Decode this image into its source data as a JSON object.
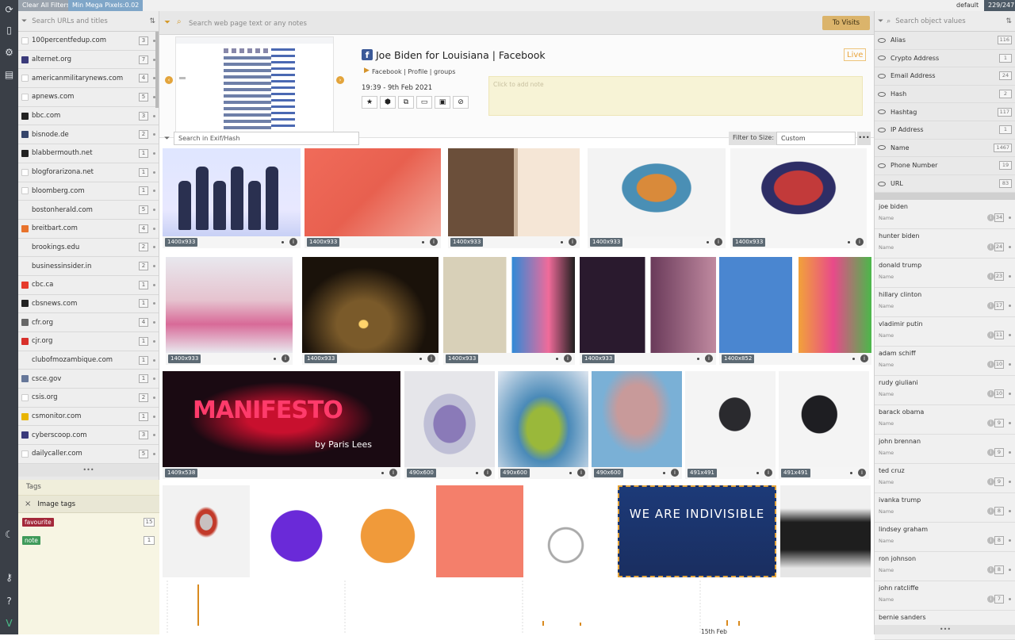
{
  "topbar": {
    "clear_filters": "Clear All Filters",
    "min_pixels": "Min Mega Pixels:0.02",
    "profile": "default",
    "counter": "229/247"
  },
  "left": {
    "search_placeholder": "Search URLs and titles",
    "domains": [
      {
        "name": "100percentfedup.com",
        "count": "3",
        "color": "#ffffff"
      },
      {
        "name": "alternet.org",
        "count": "7",
        "color": "#3a3a7a"
      },
      {
        "name": "americanmilitarynews.com",
        "count": "4",
        "color": "#ffffff"
      },
      {
        "name": "apnews.com",
        "count": "5",
        "color": "#ffffff"
      },
      {
        "name": "bbc.com",
        "count": "3",
        "color": "#222222"
      },
      {
        "name": "bisnode.de",
        "count": "2",
        "color": "#35456a"
      },
      {
        "name": "blabbermouth.net",
        "count": "1",
        "color": "#222222"
      },
      {
        "name": "blogforarizona.net",
        "count": "1",
        "color": "#ffffff"
      },
      {
        "name": "bloomberg.com",
        "count": "1",
        "color": "#ffffff"
      },
      {
        "name": "bostonherald.com",
        "count": "5",
        "color": "transparent"
      },
      {
        "name": "breitbart.com",
        "count": "4",
        "color": "#e8732c"
      },
      {
        "name": "brookings.edu",
        "count": "2",
        "color": "transparent"
      },
      {
        "name": "businessinsider.in",
        "count": "2",
        "color": "transparent"
      },
      {
        "name": "cbc.ca",
        "count": "1",
        "color": "#e63a2b"
      },
      {
        "name": "cbsnews.com",
        "count": "1",
        "color": "#222222"
      },
      {
        "name": "cfr.org",
        "count": "4",
        "color": "#666666"
      },
      {
        "name": "cjr.org",
        "count": "1",
        "color": "#d8302b"
      },
      {
        "name": "clubofmozambique.com",
        "count": "1",
        "color": "transparent"
      },
      {
        "name": "csce.gov",
        "count": "1",
        "color": "#667799"
      },
      {
        "name": "csis.org",
        "count": "2",
        "color": "#ffffff"
      },
      {
        "name": "csmonitor.com",
        "count": "1",
        "color": "#e8b400"
      },
      {
        "name": "cyberscoop.com",
        "count": "3",
        "color": "#3a3a7a"
      },
      {
        "name": "dailycaller.com",
        "count": "5",
        "color": "#ffffff"
      }
    ],
    "more": "•••",
    "tags_title": "Tags",
    "image_tags_title": "Image tags",
    "tags": [
      {
        "label": "favourite",
        "count": "15",
        "color": "#a3283a"
      },
      {
        "label": "note",
        "count": "1",
        "color": "#3f9a5a"
      }
    ]
  },
  "center": {
    "search_placeholder": "Search web page text or any notes",
    "visits_button": "To Visits",
    "page_title": "Joe Biden for Louisiana | Facebook",
    "breadcrumb": "Facebook | Profile | groups",
    "timestamp": "19:39 - 9th Feb 2021",
    "live_label": "Live",
    "note_placeholder": "Click to add note",
    "exif_placeholder": "Search in Exif/Hash",
    "filter_size_label": "Filter to Size:",
    "filter_size_value": "Custom",
    "timeline_label": "15th Feb",
    "images": [
      {
        "dim": "1400x933"
      },
      {
        "dim": "1400x933"
      },
      {
        "dim": "1400x933"
      },
      {
        "dim": "1400x933"
      },
      {
        "dim": "1400x933"
      },
      {
        "dim": "1400x933"
      },
      {
        "dim": "1400x933"
      },
      {
        "dim": "1400x933"
      },
      {
        "dim": "1400x933"
      },
      {
        "dim": "1400x852"
      },
      {
        "dim": "1409x538"
      },
      {
        "dim": "490x600"
      },
      {
        "dim": "490x600"
      },
      {
        "dim": "490x600"
      },
      {
        "dim": "491x491"
      },
      {
        "dim": "491x491"
      },
      {
        "dim": ""
      },
      {
        "dim": ""
      },
      {
        "dim": ""
      },
      {
        "dim": ""
      },
      {
        "dim": ""
      },
      {
        "dim": ""
      },
      {
        "dim": ""
      }
    ],
    "manifesto_title": "MANIFESTO",
    "manifesto_sub": "by Paris Lees",
    "indivisible": "WE ARE INDIVISIBLE"
  },
  "right": {
    "search_placeholder": "Search object values",
    "objects": [
      {
        "name": "Alias",
        "count": "116"
      },
      {
        "name": "Crypto Address",
        "count": "1"
      },
      {
        "name": "Email Address",
        "count": "24"
      },
      {
        "name": "Hash",
        "count": "2"
      },
      {
        "name": "Hashtag",
        "count": "117"
      },
      {
        "name": "IP Address",
        "count": "1"
      },
      {
        "name": "Name",
        "count": "1467"
      },
      {
        "name": "Phone Number",
        "count": "19"
      },
      {
        "name": "URL",
        "count": "83"
      }
    ],
    "values": [
      {
        "name": "joe biden",
        "type": "Name",
        "count": "34"
      },
      {
        "name": "hunter biden",
        "type": "Name",
        "count": "24"
      },
      {
        "name": "donald trump",
        "type": "Name",
        "count": "23"
      },
      {
        "name": "hillary clinton",
        "type": "Name",
        "count": "17"
      },
      {
        "name": "vladimir putin",
        "type": "Name",
        "count": "11"
      },
      {
        "name": "adam schiff",
        "type": "Name",
        "count": "10"
      },
      {
        "name": "rudy giuliani",
        "type": "Name",
        "count": "10"
      },
      {
        "name": "barack obama",
        "type": "Name",
        "count": "9"
      },
      {
        "name": "john brennan",
        "type": "Name",
        "count": "9"
      },
      {
        "name": "ted cruz",
        "type": "Name",
        "count": "9"
      },
      {
        "name": "ivanka trump",
        "type": "Name",
        "count": "8"
      },
      {
        "name": "lindsey graham",
        "type": "Name",
        "count": "8"
      },
      {
        "name": "ron johnson",
        "type": "Name",
        "count": "8"
      },
      {
        "name": "john ratcliffe",
        "type": "Name",
        "count": "7"
      },
      {
        "name": "bernie sanders",
        "type": "Name",
        "count": ""
      }
    ],
    "more": "•••"
  }
}
